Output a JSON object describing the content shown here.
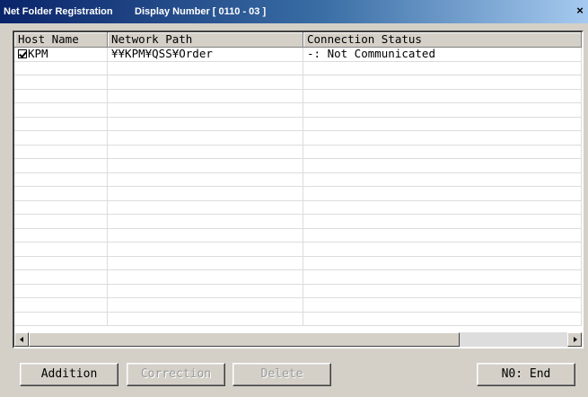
{
  "window": {
    "title": "Net Folder Registration",
    "display_number": "Display Number [ 0110 - 03 ]",
    "close_glyph": "×"
  },
  "table": {
    "columns": [
      "Host Name",
      "Network Path",
      "Connection Status"
    ],
    "rows": [
      {
        "checked": true,
        "host": "KPM",
        "path": "¥¥KPM¥QSS¥Order",
        "status": "-: Not Communicated"
      }
    ],
    "empty_rows": 19
  },
  "buttons": {
    "addition": "Addition",
    "correction": "Correction",
    "delete": "Delete",
    "end": "N0: End"
  },
  "icons": [
    "checkbox-checked-icon",
    "scroll-left-icon",
    "scroll-right-icon",
    "close-icon"
  ]
}
